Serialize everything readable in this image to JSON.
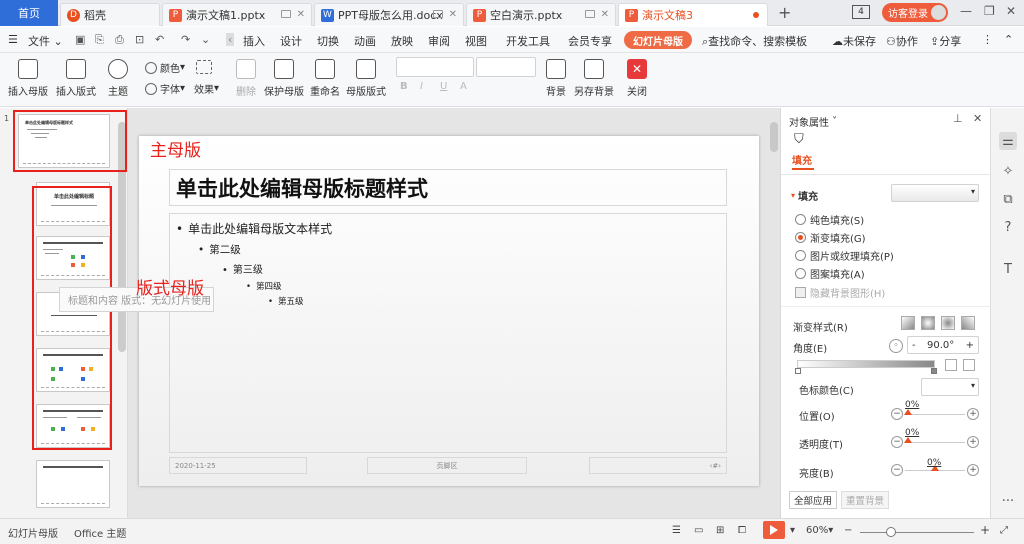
{
  "tabbar": {
    "home": "首页",
    "tabs": [
      {
        "label": "稻壳",
        "kind": "docer"
      },
      {
        "label": "演示文稿1.pptx",
        "kind": "ppt"
      },
      {
        "label": "PPT母版怎么用.docx",
        "kind": "word"
      },
      {
        "label": "空白演示.pptx",
        "kind": "ppt"
      },
      {
        "label": "演示文稿3",
        "kind": "ppt"
      }
    ],
    "add_tab": "+",
    "window_count": "4",
    "login": "访客登录"
  },
  "menubar": {
    "file": "文件",
    "items": [
      "插入",
      "设计",
      "切换",
      "动画",
      "放映",
      "审阅",
      "视图",
      "开发工具",
      "会员专享"
    ],
    "active_tab": "幻灯片母版",
    "search": "查找命令、搜索模板",
    "unsaved": "未保存",
    "collab": "协作",
    "share": "分享"
  },
  "ribbon": {
    "insert_master": "插入母版",
    "insert_layout": "插入版式",
    "theme": "主题",
    "color": "颜色",
    "font": "字体",
    "effect": "效果",
    "delete": "删除",
    "protect_master": "保护母版",
    "rename": "重命名",
    "master_layout": "母版版式",
    "font_bold": "B",
    "font_italic": "I",
    "font_underline": "U",
    "font_color": "A",
    "background": "背景",
    "save_background": "另存背景",
    "close": "关闭"
  },
  "thumbnails": {
    "main_title": "单击此处编辑母版标题样式",
    "layout_title": "单击此处编辑标题",
    "tooltip": "标题和内容 版式：无幻灯片使用",
    "slide_number": "1"
  },
  "annotations": {
    "main_master": "主母版",
    "layout_master": "版式母版"
  },
  "slide": {
    "title": "单击此处编辑母版标题样式",
    "levels": [
      "单击此处编辑母版文本样式",
      "第二级",
      "第三级",
      "第四级",
      "第五级"
    ],
    "footer_date": "2020-11-25",
    "footer_center": "页脚区",
    "footer_num": "‹#›"
  },
  "props": {
    "title": "对象属性",
    "tab_fill": "填充",
    "section_fill": "填充",
    "options": [
      "纯色填充(S)",
      "渐变填充(G)",
      "图片或纹理填充(P)",
      "图案填充(A)"
    ],
    "selected_option": 1,
    "hide_bg": "隐藏背景图形(H)",
    "gradient_style": "渐变样式(R)",
    "angle_label": "角度(E)",
    "angle_value": "90.0°",
    "minus": "-",
    "plus": "+",
    "stop_color": "色标颜色(C)",
    "position": "位置(O)",
    "position_value": "0%",
    "transparency": "透明度(T)",
    "transparency_value": "0%",
    "brightness": "亮度(B)",
    "brightness_value": "0%",
    "apply_all": "全部应用",
    "reset_bg": "重置背景"
  },
  "statusbar": {
    "mode": "幻灯片母版",
    "theme": "Office 主题",
    "zoom": "60%",
    "zoom_minus": "−",
    "zoom_plus": "+"
  },
  "colors": {
    "accent": "#ef5c3b",
    "home_blue": "#2f6dd9",
    "annotation_red": "#e8211d"
  }
}
